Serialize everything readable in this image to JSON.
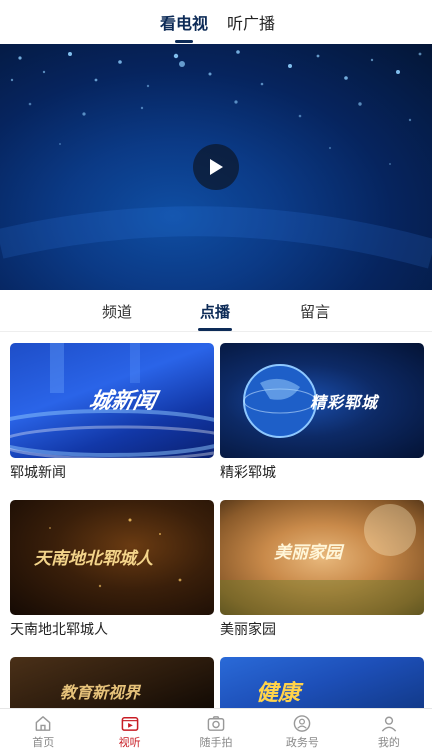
{
  "top_tabs": [
    {
      "label": "看电视",
      "active": true
    },
    {
      "label": "听广播",
      "active": false
    }
  ],
  "player": {
    "play_icon": "play-icon"
  },
  "sub_tabs": [
    {
      "label": "频道",
      "active": false
    },
    {
      "label": "点播",
      "active": true
    },
    {
      "label": "留言",
      "active": false
    }
  ],
  "programs": [
    {
      "title": "郓城新闻",
      "thumb_text": "城新闻"
    },
    {
      "title": "精彩郓城",
      "thumb_text": "精彩郓城"
    },
    {
      "title": "天南地北郓城人",
      "thumb_text": "天南地北郓城人"
    },
    {
      "title": "美丽家园",
      "thumb_text": "美丽家园"
    },
    {
      "title": "",
      "thumb_text": "教育新视界"
    },
    {
      "title": "",
      "thumb_text": "健康"
    }
  ],
  "bottom_nav": [
    {
      "label": "首页",
      "icon": "home-icon",
      "active": false
    },
    {
      "label": "视听",
      "icon": "video-icon",
      "active": true
    },
    {
      "label": "随手拍",
      "icon": "camera-icon",
      "active": false
    },
    {
      "label": "政务号",
      "icon": "gov-icon",
      "active": false
    },
    {
      "label": "我的",
      "icon": "user-icon",
      "active": false
    }
  ],
  "colors": {
    "accent": "#0d2b57",
    "nav_active": "#c81d25",
    "nav_inactive": "#888888"
  }
}
